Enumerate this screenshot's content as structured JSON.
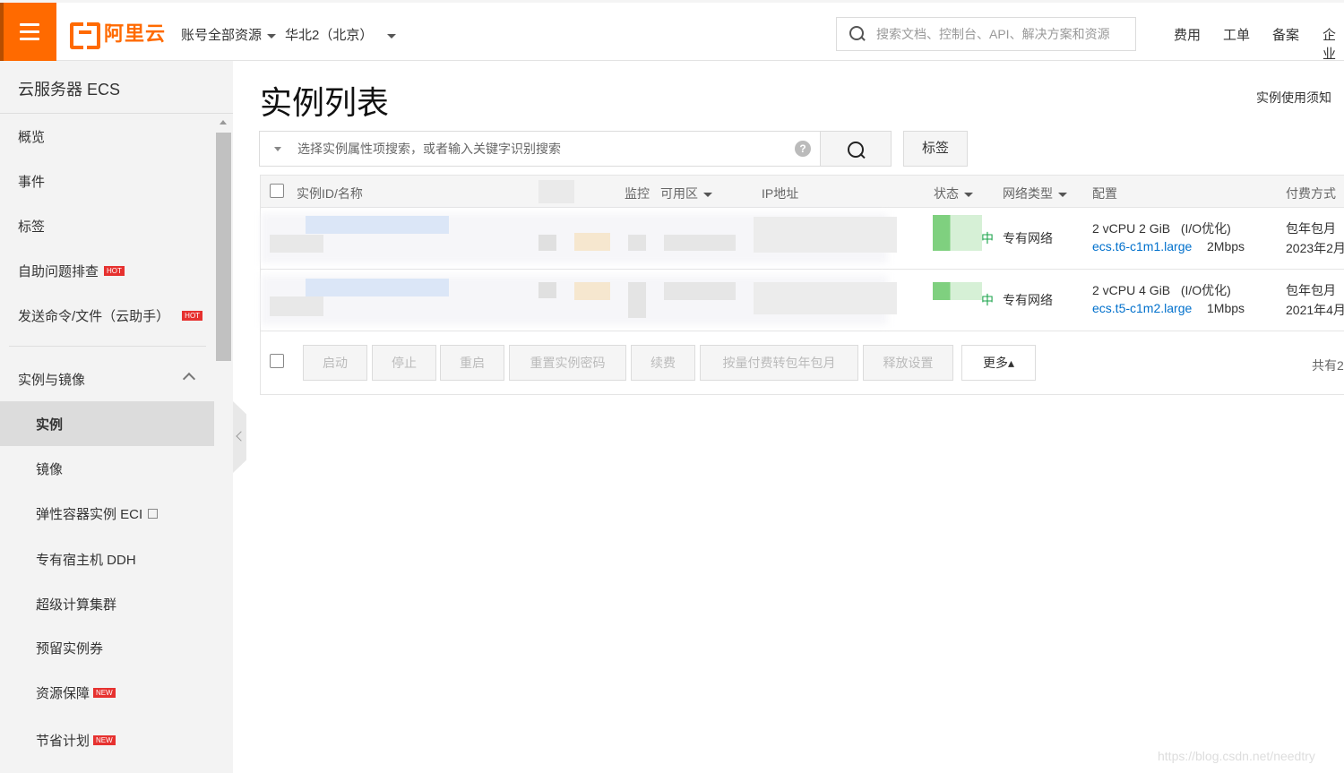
{
  "header": {
    "brand": "阿里云",
    "account_scope": "账号全部资源",
    "region": "华北2（北京）",
    "search_placeholder": "搜索文档、控制台、API、解决方案和资源",
    "links": [
      "费用",
      "工单",
      "备案",
      "企业"
    ]
  },
  "sidebar": {
    "title": "云服务器 ECS",
    "items": [
      {
        "label": "概览"
      },
      {
        "label": "事件"
      },
      {
        "label": "标签"
      },
      {
        "label": "自助问题排查",
        "badge": "HOT"
      },
      {
        "label": "发送命令/文件（云助手）",
        "badge": "HOT"
      }
    ],
    "group": "实例与镜像",
    "sub_items": [
      {
        "label": "实例"
      },
      {
        "label": "镜像"
      },
      {
        "label": "弹性容器实例 ECI"
      },
      {
        "label": "专有宿主机 DDH"
      },
      {
        "label": "超级计算集群"
      },
      {
        "label": "预留实例券"
      },
      {
        "label": "资源保障",
        "badge": "NEW"
      },
      {
        "label": "节省计划",
        "badge": "NEW"
      }
    ]
  },
  "main": {
    "title": "实例列表",
    "notice_link": "实例使用须知",
    "filter_placeholder": "选择实例属性项搜索，或者输入关键字识别搜索",
    "help_icon": "?",
    "tag_button": "标签"
  },
  "table": {
    "headers": {
      "name": "实例ID/名称",
      "monitor": "监控",
      "zone": "可用区",
      "ip": "IP地址",
      "status": "状态",
      "network": "网络类型",
      "config": "配置",
      "billing": "付费方式"
    },
    "rows": [
      {
        "status": "中",
        "network": "专有网络",
        "spec": "2 vCPU 2 GiB",
        "io": "(I/O优化)",
        "type": "ecs.t6-c1m1.large",
        "bandwidth": "2Mbps",
        "billing": "包年包月",
        "billing_date": "2023年2月"
      },
      {
        "status": "中",
        "network": "专有网络",
        "spec": "2 vCPU 4 GiB",
        "io": "(I/O优化)",
        "type": "ecs.t5-c1m2.large",
        "bandwidth": "1Mbps",
        "billing": "包年包月",
        "billing_date": "2021年4月"
      }
    ]
  },
  "bulk_actions": [
    "启动",
    "停止",
    "重启",
    "重置实例密码",
    "续费",
    "按量付费转包年包月",
    "释放设置",
    "更多▴"
  ],
  "total_text": "共有2",
  "watermark": "https://blog.csdn.net/needtry",
  "colors": {
    "brand": "#ff6a00",
    "link": "#0070cc",
    "running": "#1aa34a"
  }
}
